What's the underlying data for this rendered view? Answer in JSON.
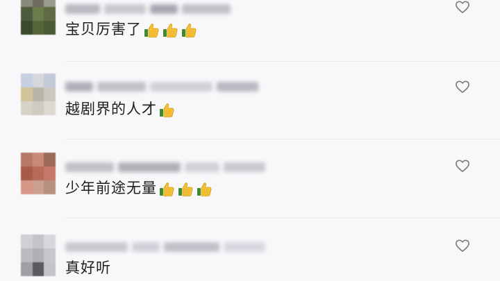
{
  "colors": {
    "background": "#f8f8fa",
    "text": "#1e1e1e",
    "icon": "#7a7a7a"
  },
  "comments": [
    {
      "text": "宝贝厉害了",
      "emoji_count": 3,
      "emoji_icon": "thumbs-up-icon",
      "avatar_colors": [
        "#8a8a7a",
        "#6f6b5e",
        "#9a9b8c",
        "#4e5a3c",
        "#6b7d4b",
        "#5e6b45",
        "#3a4a2c",
        "#56663a",
        "#4a5a34"
      ],
      "name_colors": [
        "#b8b8c0",
        "#c8c8d0",
        "#a8a8b4",
        "#c0c0c8"
      ]
    },
    {
      "text": "越剧界的人才",
      "emoji_count": 1,
      "emoji_icon": "thumbs-up-icon",
      "avatar_colors": [
        "#c7cfe2",
        "#d7d8da",
        "#c2cad8",
        "#d1c39a",
        "#b9b6a8",
        "#c9c7bf",
        "#d6d2c6",
        "#cfcbc0",
        "#ddd9d0"
      ],
      "name_colors": [
        "#b0b0b8",
        "#c0c0c8",
        "#d0d0d8",
        "#b8b8c0"
      ]
    },
    {
      "text": "少年前途无量",
      "emoji_count": 3,
      "emoji_icon": "thumbs-up-icon",
      "avatar_colors": [
        "#b87a68",
        "#c98a78",
        "#9c6a58",
        "#a85c48",
        "#b86a58",
        "#c87868",
        "#d89888",
        "#caa090",
        "#b89080"
      ],
      "name_colors": [
        "#c0c0c8",
        "#b0b0b8",
        "#d0d0d8",
        "#c8c8d0"
      ]
    },
    {
      "text": "真好听",
      "emoji_count": 0,
      "emoji_icon": "",
      "avatar_colors": [
        "#d0d0d4",
        "#c4c4c8",
        "#d8d8dc",
        "#bcbcc0",
        "#b0b0b4",
        "#c8c8cc",
        "#a0a0a4",
        "#5a5a5e",
        "#c4c4c8"
      ],
      "name_colors": [
        "#c8c8d0",
        "#d0d0d8",
        "#c0c0c8",
        "#d8d8e0"
      ]
    }
  ],
  "like_icon": "heart-outline-icon"
}
